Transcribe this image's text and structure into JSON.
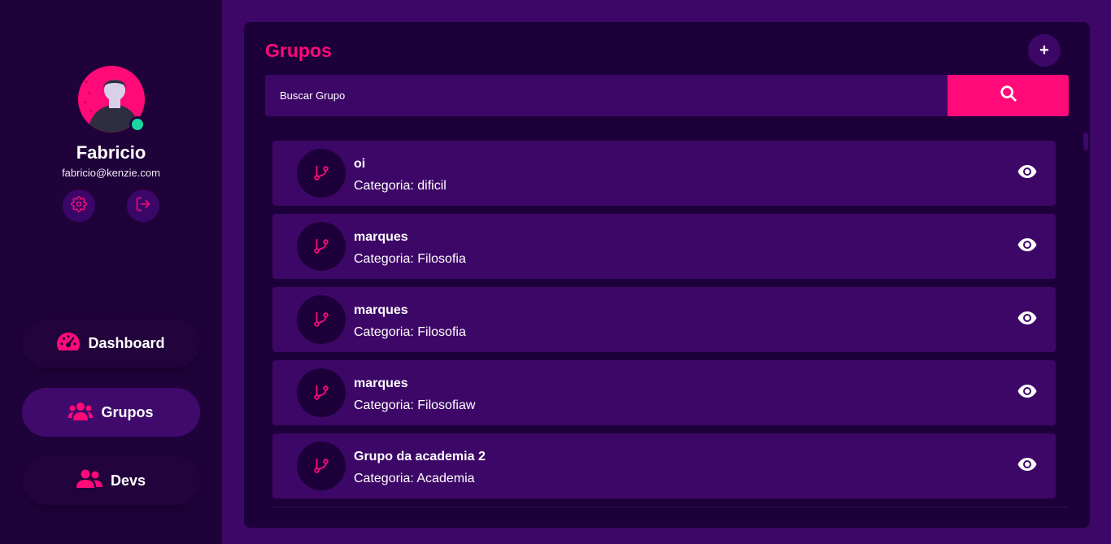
{
  "user": {
    "name": "Fabricio",
    "email": "fabricio@kenzie.com",
    "status": "online"
  },
  "sidebar": {
    "settings_icon": "gear-icon",
    "logout_icon": "logout-icon",
    "nav": [
      {
        "label": "Dashboard",
        "icon": "speedometer-icon",
        "active": false
      },
      {
        "label": "Grupos",
        "icon": "users-icon",
        "active": true
      },
      {
        "label": "Devs",
        "icon": "user-friends-icon",
        "active": false
      }
    ]
  },
  "main": {
    "title": "Grupos",
    "add_label": "+",
    "search": {
      "placeholder": "Buscar Grupo",
      "value": ""
    },
    "groups": [
      {
        "name": "oi",
        "category": "Categoria: dificil"
      },
      {
        "name": "marques",
        "category": "Categoria: Filosofia"
      },
      {
        "name": "marques",
        "category": "Categoria: Filosofia"
      },
      {
        "name": "marques",
        "category": "Categoria: Filosofiaw"
      },
      {
        "name": "Grupo da academia 2",
        "category": "Categoria: Academia"
      }
    ]
  },
  "colors": {
    "accent": "#ff0a78",
    "sidebar_bg": "#20023a",
    "panel_bg": "#1d003a",
    "card_bg": "#3d0767",
    "online": "#1ad7a0"
  }
}
